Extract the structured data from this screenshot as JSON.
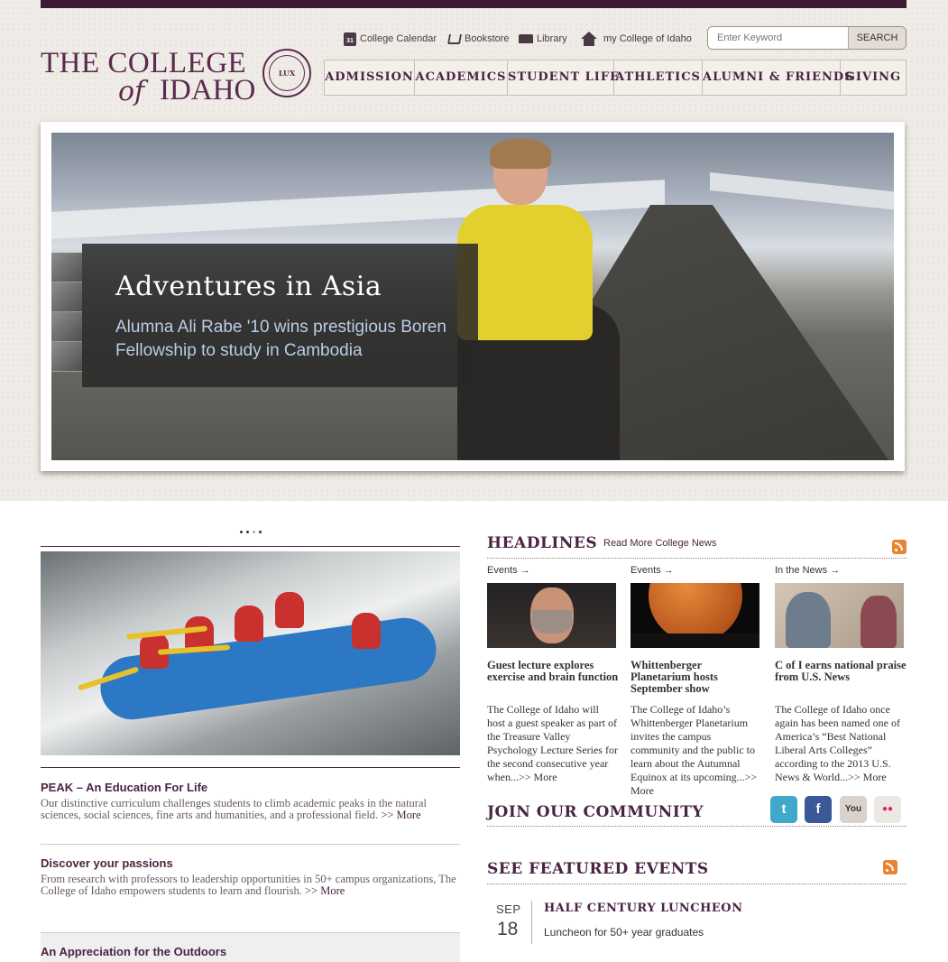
{
  "utility_nav": [
    {
      "label": "College Calendar",
      "icon": "calendar-icon"
    },
    {
      "label": "Bookstore",
      "icon": "cart-icon"
    },
    {
      "label": "Library",
      "icon": "book-icon"
    },
    {
      "label": "my College of Idaho",
      "icon": "home-icon"
    }
  ],
  "calendar_icon_text": "31",
  "search": {
    "placeholder": "Enter Keyword",
    "button": "SEARCH"
  },
  "logo": {
    "line1": "THE COLLEGE",
    "of": "of",
    "line2": "IDAHO",
    "seal_text": "LUX"
  },
  "main_nav": [
    "ADMISSION",
    "ACADEMICS",
    "STUDENT LIFE",
    "ATHLETICS",
    "ALUMNI & FRIENDS",
    "GIVING"
  ],
  "hero": {
    "title": "Adventures in Asia",
    "subtitle": "Alumna Ali Rabe '10 wins prestigious Boren Fellowship to study in Cambodia"
  },
  "features": [
    {
      "title": "PEAK – An Education For Life",
      "text": "Our distinctive curriculum challenges students to climb academic peaks in the natural sciences, social sciences, fine arts and humanities, and a professional field.",
      "more": ">> More"
    },
    {
      "title": "Discover your passions",
      "text": "From research with professors to leadership opportunities in 50+ campus organizations, The College of Idaho empowers students to learn and flourish.",
      "more": ">> More"
    },
    {
      "title": "An Appreciation for the Outdoors"
    }
  ],
  "headlines": {
    "heading": "HEADLINES",
    "read_more": "Read More College News",
    "items": [
      {
        "category": "Events  →",
        "title": "Guest lecture explores exercise and brain function",
        "text": "The College of Idaho will host a guest speaker as part of the Treasure Valley Psychology Lecture Series for the second consecutive year when...",
        "more": ">> More"
      },
      {
        "category": "Events  →",
        "title": "Whittenberger Planetarium hosts September show",
        "text": "The College of Idaho’s Whittenberger Planetarium invites the campus community and the public to learn about the Autumnal Equinox at its upcoming...",
        "more": ">> More"
      },
      {
        "category": "In the News  →",
        "title": "C of I earns national praise from U.S. News",
        "text": "The College of Idaho once again has been named one of America’s “Best National Liberal Arts Colleges” according to the 2013 U.S. News & World...",
        "more": ">> More"
      }
    ]
  },
  "community": {
    "heading": "JOIN OUR COMMUNITY",
    "icons": [
      {
        "name": "twitter-icon",
        "glyph": "t",
        "color": "#3fa9c9"
      },
      {
        "name": "facebook-icon",
        "glyph": "f",
        "color": "#3b5998"
      },
      {
        "name": "youtube-icon",
        "glyph": "You",
        "color": "#d9d2cc"
      },
      {
        "name": "flickr-icon",
        "glyph": "●●",
        "color": "#ece8e4"
      }
    ]
  },
  "events": {
    "heading": "SEE FEATURED EVENTS",
    "items": [
      {
        "month": "SEP",
        "day": "18",
        "title": "HALF CENTURY LUNCHEON",
        "desc": "Luncheon for 50+ year graduates"
      }
    ]
  }
}
